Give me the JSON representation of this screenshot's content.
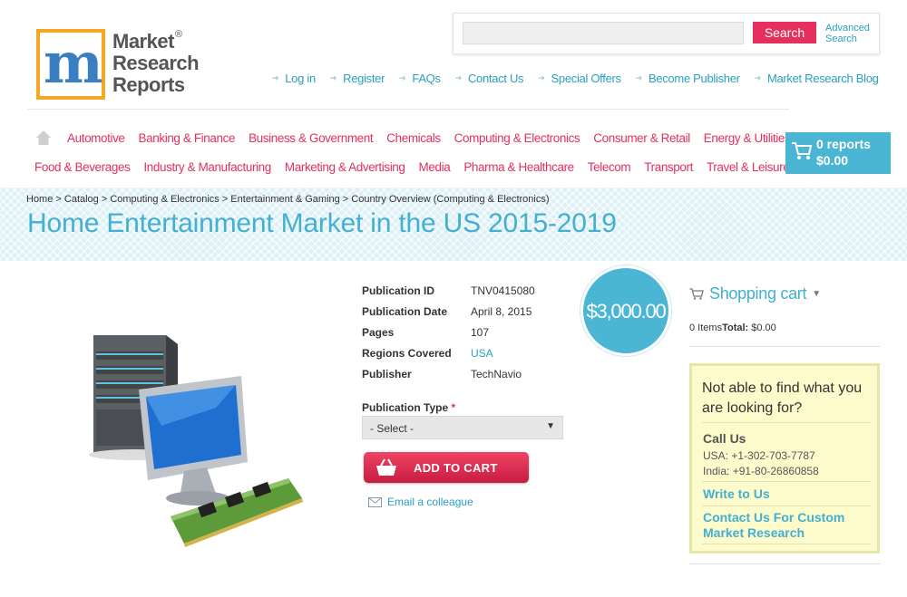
{
  "logo": {
    "line1": "Market",
    "line2": "Research",
    "line3": "Reports",
    "reg": "®"
  },
  "search": {
    "placeholder": "",
    "button": "Search",
    "advanced_line1": "Advanced",
    "advanced_line2": "Search"
  },
  "topnav": [
    "Log in",
    "Register",
    "FAQs",
    "Contact Us",
    "Special Offers",
    "Become Publisher",
    "Market Research Blog"
  ],
  "categories_row1": [
    "Automotive",
    "Banking & Finance",
    "Business & Government",
    "Chemicals",
    "Computing & Electronics",
    "Consumer & Retail",
    "Energy & Utilities"
  ],
  "categories_row2": [
    "Food & Beverages",
    "Industry & Manufacturing",
    "Marketing & Advertising",
    "Media",
    "Pharma & Healthcare",
    "Telecom",
    "Transport",
    "Travel & Leisure"
  ],
  "cart_box": {
    "reports": "0 reports",
    "total": "$0.00"
  },
  "breadcrumb": "Home > Catalog > Computing & Electronics > Entertainment & Gaming > Country Overview (Computing & Electronics)",
  "page_title": "Home Entertainment Market in the US 2015-2019",
  "details": {
    "pub_id_label": "Publication ID",
    "pub_id": "TNV0415080",
    "pub_date_label": "Publication Date",
    "pub_date": "April 8, 2015",
    "pages_label": "Pages",
    "pages": "107",
    "regions_label": "Regions Covered",
    "regions": "USA",
    "publisher_label": "Publisher",
    "publisher": "TechNavio"
  },
  "pub_type": {
    "label": "Publication Type",
    "required": "*",
    "selected": "- Select -"
  },
  "add_to_cart": "ADD TO CART",
  "email_colleague": "Email a colleague",
  "price": "$3,000.00",
  "sidebar": {
    "cart_title": "Shopping cart",
    "items_text": "0 Items",
    "total_label": "Total:",
    "total_value": "$0.00",
    "help_question": "Not able to find what you are looking for?",
    "call_us": "Call Us",
    "usa_phone": "USA: +1-302-703-7787",
    "india_phone": "India: +91-80-26860858",
    "write_us": "Write to Us",
    "custom_research": "Contact Us For Custom Market Research"
  },
  "colors": {
    "accent_pink": "#e5305e",
    "accent_blue": "#44afd0",
    "help_bg": "#fdfbcc"
  }
}
